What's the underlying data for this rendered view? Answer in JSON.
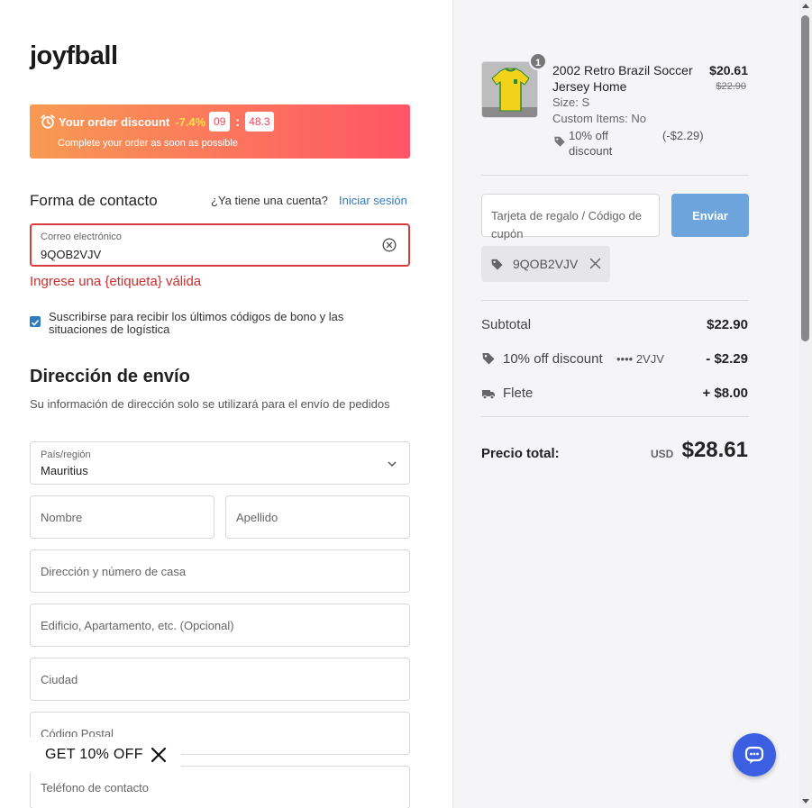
{
  "brand": {
    "logo": "joyfball"
  },
  "promo": {
    "title": "Your order discount",
    "percent": "-7.4%",
    "timer_min": "09",
    "timer_sep": ":",
    "timer_sec": "48.3",
    "subtitle": "Complete your order as soon as possible"
  },
  "contact": {
    "title": "Forma de contacto",
    "account_question": "¿Ya tiene una cuenta?",
    "login_link": "Iniciar sesión",
    "email_label": "Correo electrónico",
    "email_value": "9QOB2VJV",
    "error": "Ingrese una {etiqueta} válida",
    "subscribe": "Suscribirse para recibir los últimos códigos de bono y las situaciones de logística",
    "subscribe_checked": true
  },
  "shipping": {
    "title": "Dirección de envío",
    "description": "Su información de dirección solo se utilizará para el envío de pedidos",
    "country_label": "País/región",
    "country_value": "Mauritius",
    "first_name_ph": "Nombre",
    "last_name_ph": "Apellido",
    "address_ph": "Dirección y número de casa",
    "building_ph": "Edificio, Apartamento, etc. (Opcional)",
    "city_ph": "Ciudad",
    "postal_ph": "Código Postal",
    "phone_ph": "Teléfono de contacto"
  },
  "offer_banner": {
    "label": "GET 10% OFF"
  },
  "cart": {
    "item": {
      "quantity": "1",
      "name": "2002 Retro Brazil Soccer Jersey Home",
      "size": "Size: S",
      "custom": "Custom Items: No",
      "discount_label": "10% off discount",
      "discount_amount": "(-$2.29)",
      "price": "$20.61",
      "original_price": "$22.90"
    },
    "coupon_placeholder": "Tarjeta de regalo / Código de cupón",
    "send_button": "Enviar",
    "applied_code": "9QOB2VJV"
  },
  "summary": {
    "subtotal_label": "Subtotal",
    "subtotal_value": "$22.90",
    "discount_label": "10% off discount",
    "discount_code": "•••• 2VJV",
    "discount_value": "- $2.29",
    "shipping_label": "Flete",
    "shipping_value": "+ $8.00",
    "total_label": "Precio total:",
    "currency": "USD",
    "total_value": "$28.61"
  },
  "colors": {
    "accent": "#2f7bbf",
    "error": "#d12d2d",
    "promo_start": "#f79a52",
    "promo_end": "#fe5566",
    "send_button": "#6ea4dc",
    "chat": "#3b5fe0"
  }
}
